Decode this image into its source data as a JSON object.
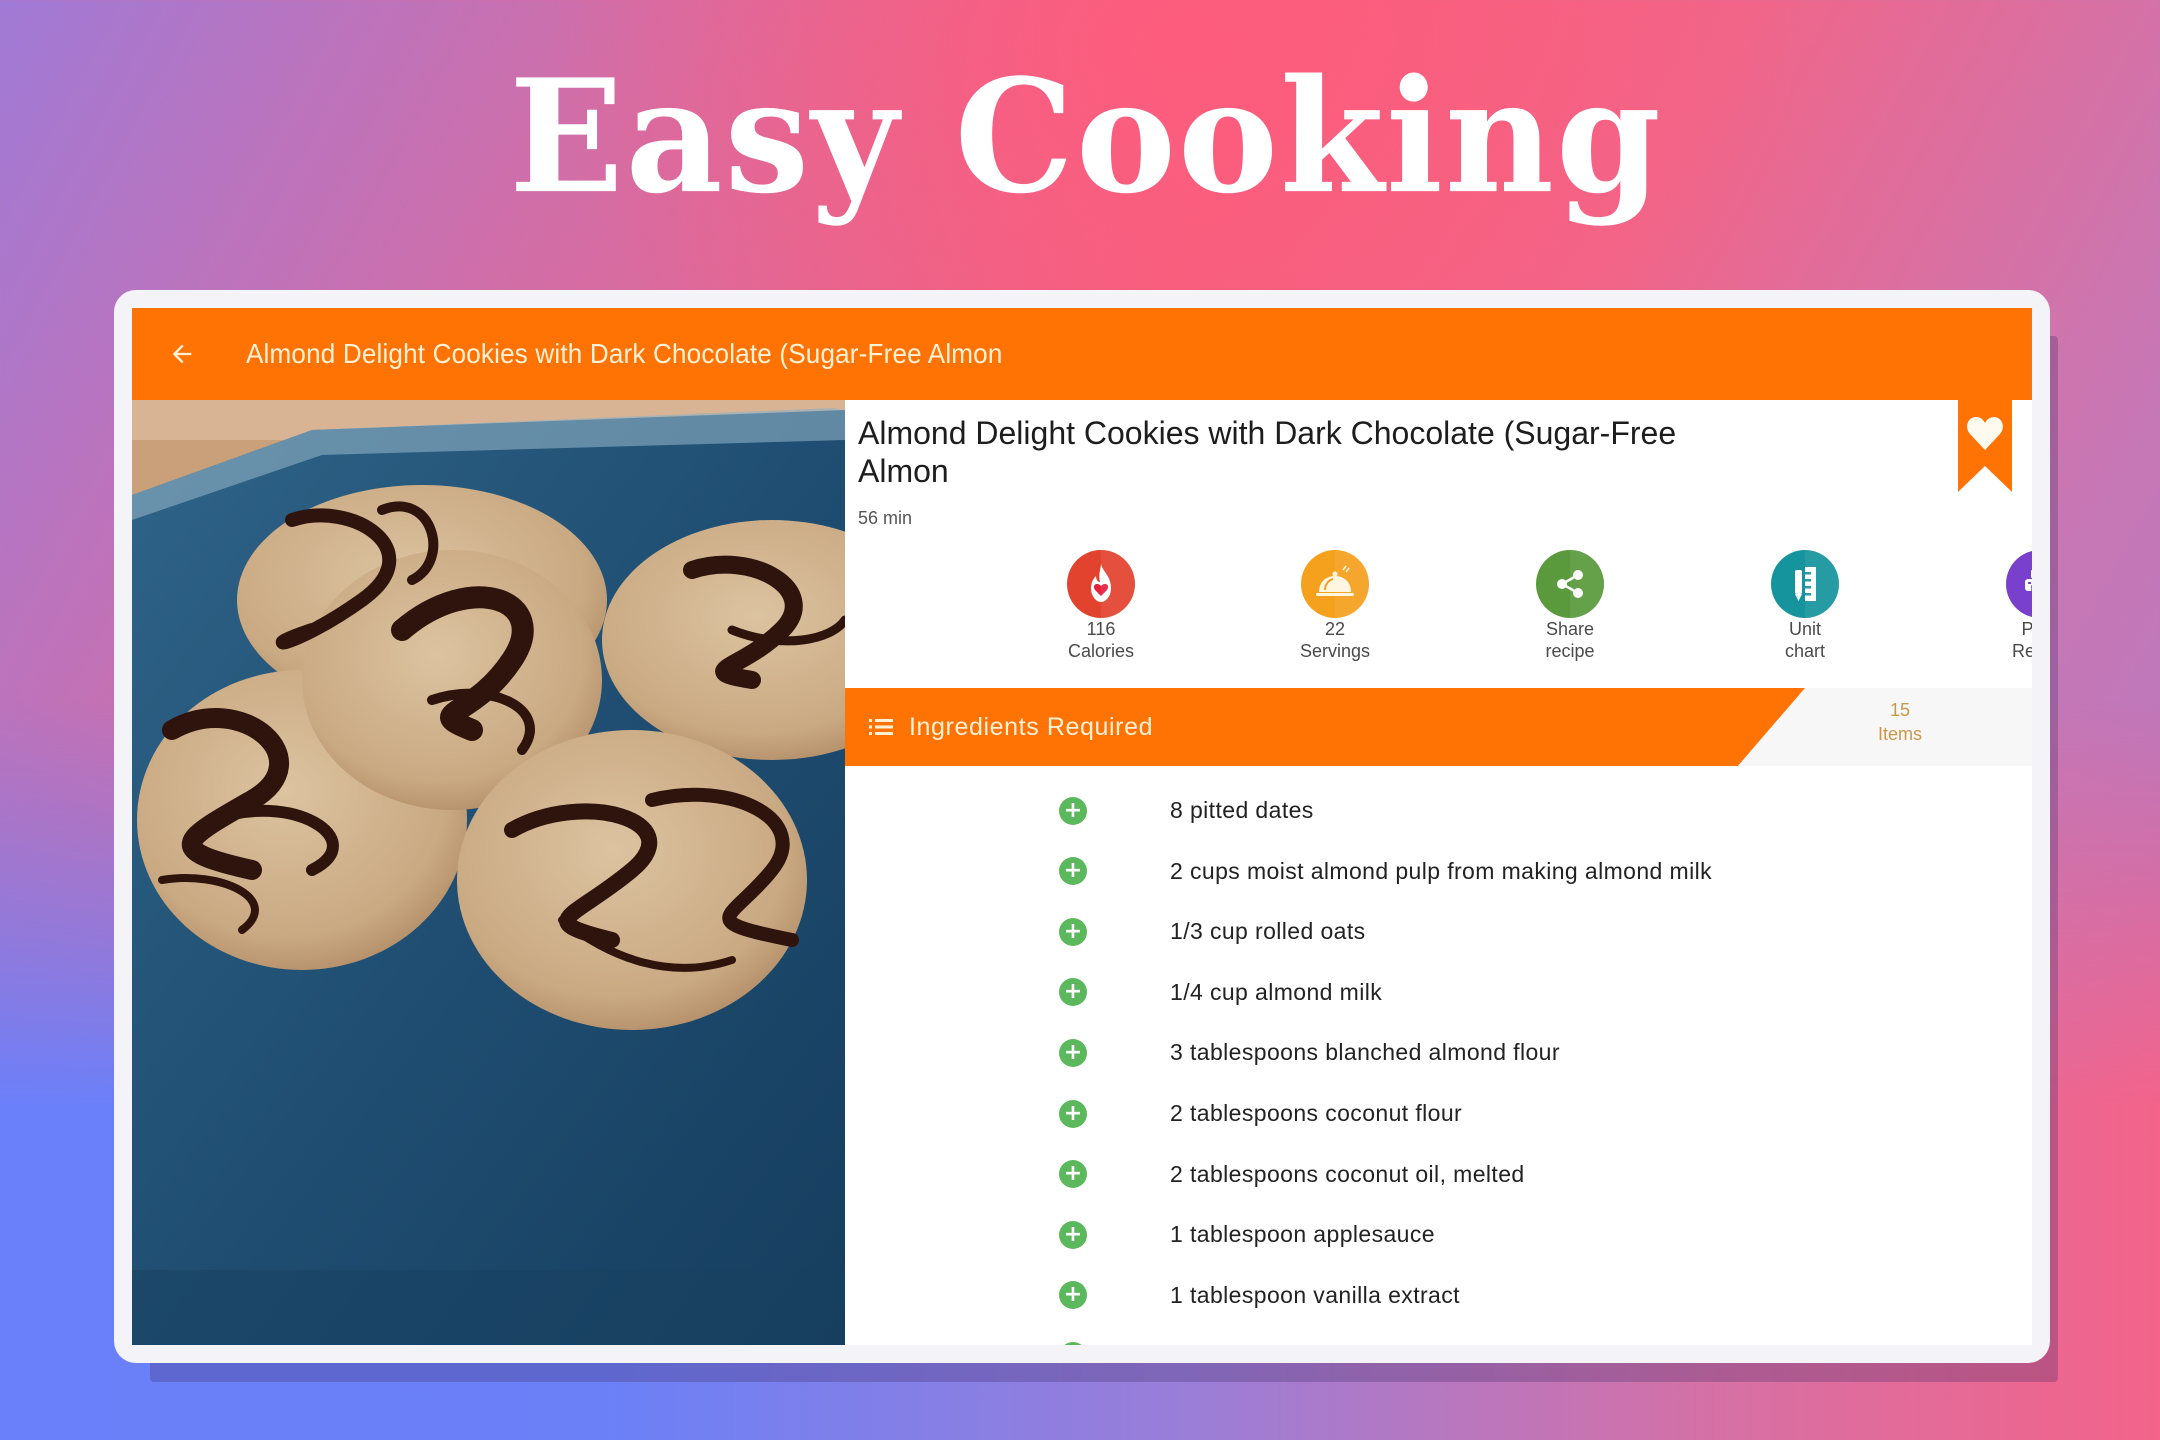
{
  "banner": {
    "headline": "Easy Cooking"
  },
  "app": {
    "accent_color": "#ff7304",
    "toolbar": {
      "back_icon": "arrow-left-icon",
      "title": "Almond Delight Cookies with Dark Chocolate (Sugar-Free Almon"
    },
    "photo": {
      "description": "Almond cookies drizzled with dark chocolate on a blue plate"
    },
    "recipe": {
      "title": "Almond Delight Cookies with Dark Chocolate (Sugar-Free Almon",
      "duration": "56 min",
      "favorite_icon": "heart-bookmark-icon"
    },
    "stats": [
      {
        "icon": "flame-heart-icon",
        "color": "#e2432f",
        "line1": "116",
        "line2": "Calories"
      },
      {
        "icon": "serving-cloche-icon",
        "color": "#f5a11e",
        "line1": "22",
        "line2": "Servings"
      },
      {
        "icon": "share-icon",
        "color": "#5a9a3c",
        "line1": "Share",
        "line2": "recipe"
      },
      {
        "icon": "ruler-pencil-icon",
        "color": "#16949e",
        "line1": "Unit",
        "line2": "chart"
      },
      {
        "icon": "printer-icon",
        "color": "#7840cc",
        "line1": "Print",
        "line2": "Recipe"
      }
    ],
    "ingredients": {
      "header_icon": "list-icon",
      "header": "Ingredients Required",
      "count": "15",
      "count_label": "Items",
      "add_icon": "plus-circle-icon",
      "items": [
        "8 pitted dates",
        "2 cups moist almond pulp from making almond milk",
        "1/3 cup rolled oats",
        "1/4 cup almond milk",
        "3 tablespoons blanched almond flour",
        "2 tablespoons coconut flour",
        "2 tablespoons coconut oil, melted",
        "1 tablespoon applesauce",
        "1 tablespoon vanilla extract"
      ]
    }
  }
}
